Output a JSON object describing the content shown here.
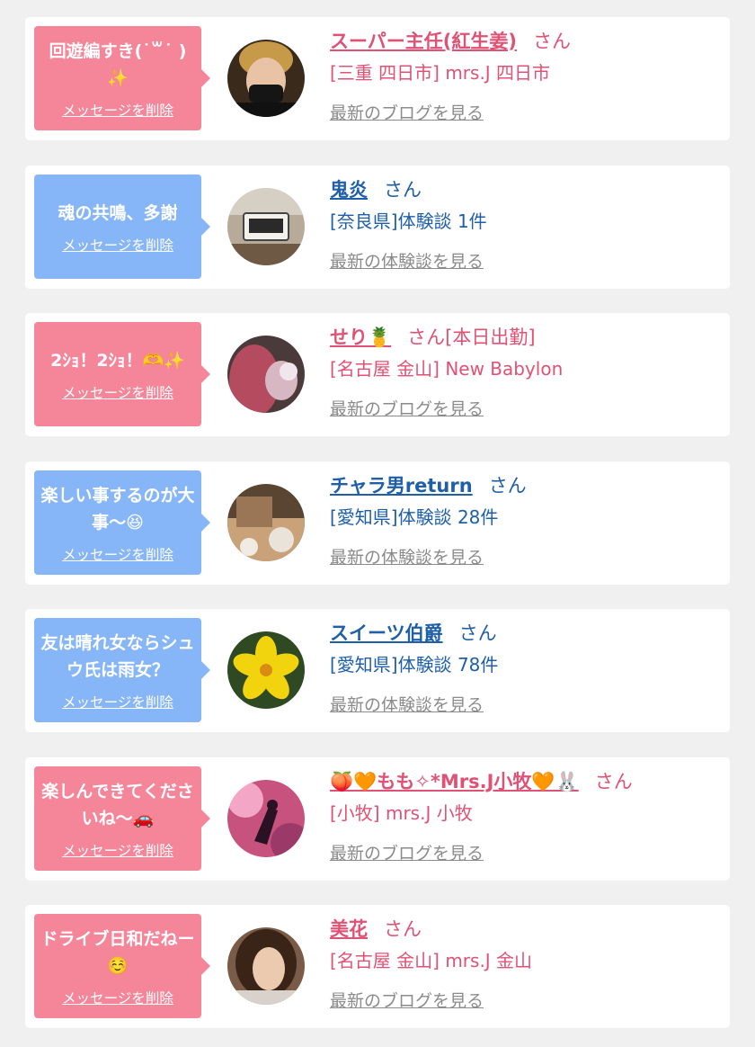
{
  "messages": [
    {
      "bubble_text": "回遊編すき(˙꒳˙ )✨",
      "delete_label": "メッセージを削除",
      "name": "スーパー主任(紅生姜)",
      "honorific": "さん",
      "meta": "[三重 四日市] mrs.J 四日市",
      "link_label": "最新のブログを見る",
      "accent": "#e05275",
      "bubble_color": "#f5869a",
      "avatar_icon": "man-with-mask-avatar"
    },
    {
      "bubble_text": "魂の共鳴、多謝",
      "delete_label": "メッセージを削除",
      "name": "鬼炎",
      "honorific": "さん",
      "meta": "[奈良県]体験談 1件",
      "link_label": "最新の体験談を見る",
      "accent": "#1f5fa8",
      "bubble_color": "#86b6f7",
      "avatar_icon": "digital-clock-avatar"
    },
    {
      "bubble_text": "2ｼｮ！2ｼｮ！🫶✨",
      "delete_label": "メッセージを削除",
      "name": "せり🍍",
      "honorific": "さん[本日出勤]",
      "meta": "[名古屋 金山] New Babylon",
      "link_label": "最新のブログを見る",
      "accent": "#e05275",
      "bubble_color": "#f5869a",
      "avatar_icon": "red-hair-avatar"
    },
    {
      "bubble_text": "楽しい事するのが大事〜😆",
      "delete_label": "メッセージを削除",
      "name": "チャラ男return",
      "honorific": "さん",
      "meta": "[愛知県]体験談 28件",
      "link_label": "最新の体験談を見る",
      "accent": "#1f5fa8",
      "bubble_color": "#86b6f7",
      "avatar_icon": "food-table-avatar"
    },
    {
      "bubble_text": "友は晴れ女ならシュウ氏は雨女？",
      "delete_label": "メッセージを削除",
      "name": "スイーツ伯爵",
      "honorific": "さん",
      "meta": "[愛知県]体験談 78件",
      "link_label": "最新の体験談を見る",
      "accent": "#1f5fa8",
      "bubble_color": "#86b6f7",
      "avatar_icon": "yellow-flower-avatar"
    },
    {
      "bubble_text": "楽しんできてくださいね〜🚗",
      "delete_label": "メッセージを削除",
      "name": "🍑🧡もも✧*Mrs.J小牧🧡🐰",
      "honorific": "さん",
      "meta": "[小牧] mrs.J 小牧",
      "link_label": "最新のブログを見る",
      "accent": "#e05275",
      "bubble_color": "#f5869a",
      "avatar_icon": "pink-silhouette-avatar"
    },
    {
      "bubble_text": "ドライブ日和だねー☺️",
      "delete_label": "メッセージを削除",
      "name": "美花",
      "honorific": "さん",
      "meta": "[名古屋 金山] mrs.J 金山",
      "link_label": "最新のブログを見る",
      "accent": "#e05275",
      "bubble_color": "#f5869a",
      "avatar_icon": "woman-portrait-avatar"
    }
  ]
}
